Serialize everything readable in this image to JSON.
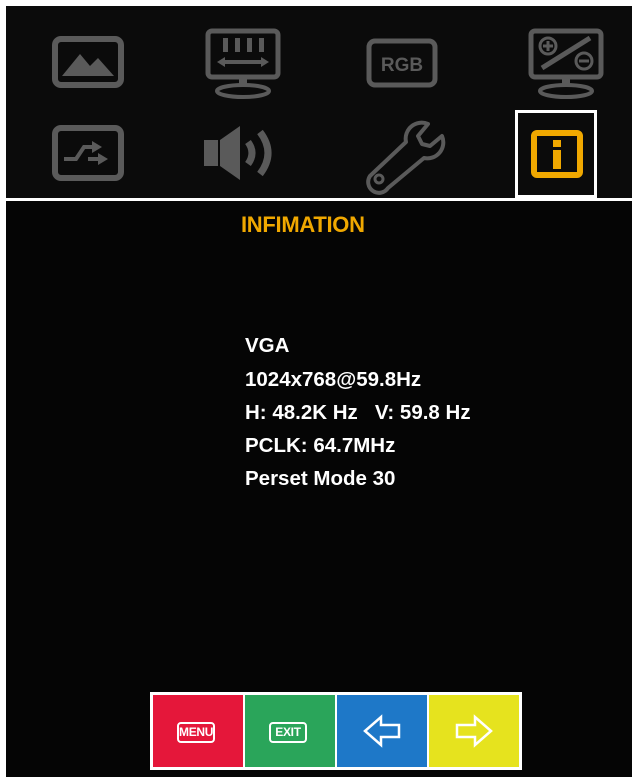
{
  "menu": {
    "icons": [
      "picture-icon",
      "geometry-icon",
      "rgb-icon",
      "color-adjust-icon",
      "input-source-icon",
      "audio-icon",
      "setup-wrench-icon",
      "information-icon"
    ],
    "selected": "information-icon",
    "rgb_text": "RGB"
  },
  "page": {
    "title": "INFIMATION",
    "info_lines": [
      "VGA",
      "1024x768@59.8Hz",
      "H: 48.2K Hz   V: 59.8 Hz",
      "PCLK: 64.7MHz",
      "Perset Mode 30"
    ]
  },
  "keys": {
    "menu_label": "MENU",
    "exit_label": "EXIT",
    "left_icon": "left-arrow-icon",
    "right_icon": "right-arrow-icon"
  },
  "colors": {
    "icon_gray": "#5a5a5a",
    "accent": "#f0a800",
    "menu_key": "#e5173a",
    "exit_key": "#2aa55a",
    "left_key": "#1e78c8",
    "right_key": "#e6e31e"
  }
}
